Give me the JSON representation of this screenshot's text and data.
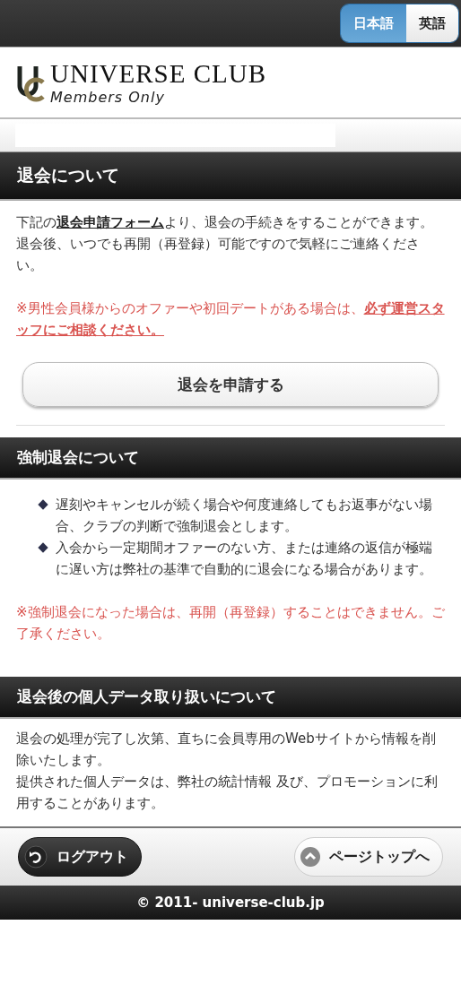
{
  "language_switch": [
    {
      "label": "日本語",
      "selected": true
    },
    {
      "label": "英語",
      "selected": false
    }
  ],
  "logo": {
    "name": "UNIVERSE CLUB",
    "tagline": "Members Only"
  },
  "sections": [
    {
      "title": "退会について",
      "kind": "withdraw",
      "intro": {
        "before": "下記の",
        "link": "退会申請フォーム",
        "after": "より、退会の手続きをすることができます。退会後、いつでも再開（再登録）可能ですので気軽にご連絡ください。"
      },
      "note": "※男性会員様からのオファーや初回デートがある場合は、**必ず運営スタッフにご相談ください。**",
      "button": "退会を申請する"
    },
    {
      "title": "強制退会について",
      "kind": "list",
      "items": [
        "遅刻やキャンセルが続く場合や何度連絡してもお返事がない場合、クラブの判断で強制退会とします。",
        "入会から一定期間オファーのない方、または連絡の返信が極端に遅い方は弊社の基準で自動的に退会になる場合があります。"
      ],
      "note": "※強制退会になった場合は、再開（再登録）することはできません。ご了承ください。"
    },
    {
      "title": "退会後の個人データ取り扱いについて",
      "kind": "text",
      "paragraphs": [
        "退会の処理が完了し次第、直ちに会員専用のWebサイトから情報を削除いたします。",
        "提供された個人データは、弊社の統計情報 及び、プロモーションに利用することがあります。"
      ]
    }
  ],
  "footer": {
    "logout": "ログアウト",
    "page_top": "ページトップへ",
    "copyright": "© 2011- universe-club.jp"
  }
}
